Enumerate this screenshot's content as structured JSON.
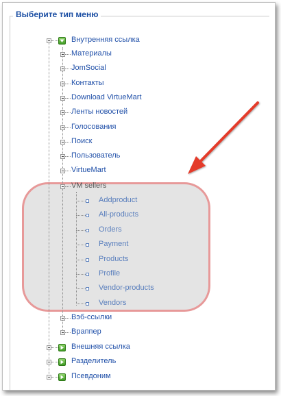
{
  "legend": "Выберите тип меню",
  "tree": {
    "internal_link": "Внутренняя ссылка",
    "children": [
      "Материалы",
      "JomSocial",
      "Контакты",
      "Download VirtueMart",
      "Ленты новостей",
      "Голосования",
      "Поиск",
      "Пользователь",
      "VirtueMart"
    ],
    "vm_sellers": "VM sellers",
    "vm_sellers_children": [
      "Addproduct",
      "All-products",
      "Orders",
      "Payment",
      "Products",
      "Profile",
      "Vendor-products",
      "Vendors"
    ],
    "more_children": [
      "Вэб-ссылки",
      "Враппер"
    ],
    "bottom_items": [
      "Внешняя ссылка",
      "Разделитель",
      "Псевдоним"
    ]
  },
  "colors": {
    "link": "#1f4fa8",
    "sublink": "#5a7fbd",
    "legend": "#1b4ea3",
    "arrow": "#e43b2a",
    "highlight_border": "#e88c8c"
  }
}
